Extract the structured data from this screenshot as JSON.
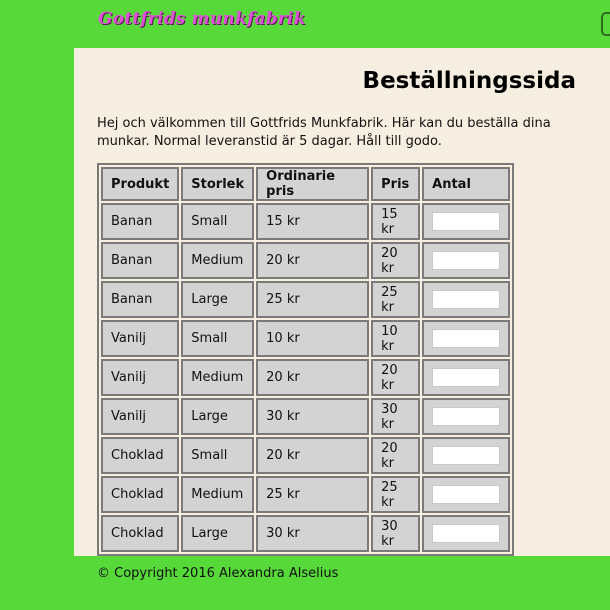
{
  "brand": {
    "name": "Gottfrids munkfabrik"
  },
  "page": {
    "title": "Beställningssida",
    "intro": "Hej och välkommen till Gottfrids Munkfabrik. Här kan du beställa dina munkar. Normal leveranstid är 5 dagar. Håll till godo."
  },
  "table": {
    "headers": {
      "product": "Produkt",
      "size": "Storlek",
      "regular_price": "Ordinarie pris",
      "price": "Pris",
      "quantity": "Antal"
    },
    "rows": [
      {
        "product": "Banan",
        "size": "Small",
        "regular_price": "15 kr",
        "price": "15 kr",
        "quantity": ""
      },
      {
        "product": "Banan",
        "size": "Medium",
        "regular_price": "20 kr",
        "price": "20 kr",
        "quantity": ""
      },
      {
        "product": "Banan",
        "size": "Large",
        "regular_price": "25 kr",
        "price": "25 kr",
        "quantity": ""
      },
      {
        "product": "Vanilj",
        "size": "Small",
        "regular_price": "10 kr",
        "price": "10 kr",
        "quantity": ""
      },
      {
        "product": "Vanilj",
        "size": "Medium",
        "regular_price": "20 kr",
        "price": "20 kr",
        "quantity": ""
      },
      {
        "product": "Vanilj",
        "size": "Large",
        "regular_price": "30 kr",
        "price": "30 kr",
        "quantity": ""
      },
      {
        "product": "Choklad",
        "size": "Small",
        "regular_price": "20 kr",
        "price": "20 kr",
        "quantity": ""
      },
      {
        "product": "Choklad",
        "size": "Medium",
        "regular_price": "25 kr",
        "price": "25 kr",
        "quantity": ""
      },
      {
        "product": "Choklad",
        "size": "Large",
        "regular_price": "30 kr",
        "price": "30 kr",
        "quantity": ""
      }
    ]
  },
  "footer": {
    "copyright": "© Copyright 2016 Alexandra Alselius"
  },
  "colors": {
    "background": "#57d93a",
    "panel": "#f6efe1",
    "cell": "#d3d3d3",
    "brand_text": "#e04fd8"
  }
}
